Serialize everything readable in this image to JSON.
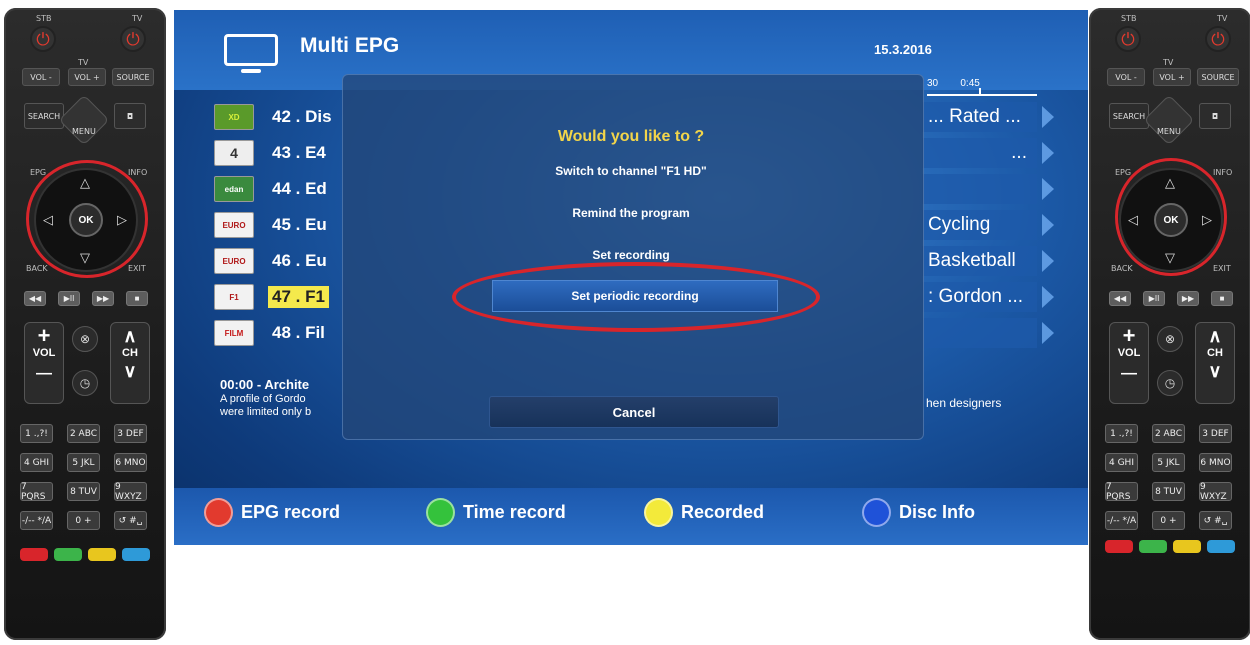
{
  "remote": {
    "stb_label": "STB",
    "tv_label": "TV",
    "tv_group_label": "TV",
    "vol_minus": "VOL -",
    "vol_plus": "VOL +",
    "source": "SOURCE",
    "search": "SEARCH",
    "menu": "MENU",
    "epg": "EPG",
    "info": "INFO",
    "ok": "OK",
    "back": "BACK",
    "exit": "EXIT",
    "vol": "VOL",
    "ch": "CH",
    "plus": "+",
    "minus": "—",
    "keys": [
      "1 .,?!",
      "2 ABC",
      "3 DEF",
      "4 GHI",
      "5 JKL",
      "6 MNO",
      "7 PQRS",
      "8 TUV",
      "9 WXYZ",
      "-/-- */A",
      "0 +",
      "↺ #␣"
    ],
    "transport": [
      "◀◀",
      "▶II",
      "▶▶",
      "■"
    ],
    "color_keys": [
      "#d8252b",
      "#3cb44a",
      "#e8c61e",
      "#2e9ad8"
    ]
  },
  "epg": {
    "title": "Multi EPG",
    "date": "15.3.2016",
    "time_scale": "30        0:45",
    "channels": [
      {
        "name": "42 . Dis",
        "logo": "XD",
        "logo_bg": "#5a9a2a",
        "logo_fg": "#d7f03a"
      },
      {
        "name": "43 . E4",
        "logo": "4",
        "logo_bg": "#eeeeee",
        "logo_fg": "#333333"
      },
      {
        "name": "44 . Ed",
        "logo": "edan",
        "logo_bg": "#3a8a3e",
        "logo_fg": "#ffffff"
      },
      {
        "name": "45 . Eu",
        "logo": "EURO",
        "logo_bg": "#f2f2f2",
        "logo_fg": "#b01818"
      },
      {
        "name": "46 . Eu",
        "logo": "EURO",
        "logo_bg": "#f2f2f2",
        "logo_fg": "#b01818"
      },
      {
        "name": "47 . F1",
        "logo": "F1",
        "logo_bg": "#f2f2f2",
        "logo_fg": "#b01818",
        "highlight": true
      },
      {
        "name": "48 . Fil",
        "logo": "FILM",
        "logo_bg": "#f2f2f2",
        "logo_fg": "#c41818"
      }
    ],
    "programs": [
      "... Rated ...",
      "...",
      "",
      "Cycling",
      "Basketball",
      ": Gordon ...",
      ""
    ],
    "info_time_title": "00:00  -  Archite",
    "info_line1": "A profile of Gordo",
    "info_line2": "were limited only b",
    "info_right": "hen designers"
  },
  "dialog": {
    "question": "Would you like to ?",
    "options": [
      "Switch to channel \"F1 HD\"",
      "Remind the program",
      "Set recording"
    ],
    "selected_option": "Set periodic recording",
    "cancel": "Cancel"
  },
  "footer": {
    "items": [
      {
        "label": "EPG record",
        "color": "#e23a2e"
      },
      {
        "label": "Time record",
        "color": "#34c23c"
      },
      {
        "label": "Recorded",
        "color": "#f3ea3a"
      },
      {
        "label": "Disc Info",
        "color": "#1f52d8"
      }
    ]
  }
}
